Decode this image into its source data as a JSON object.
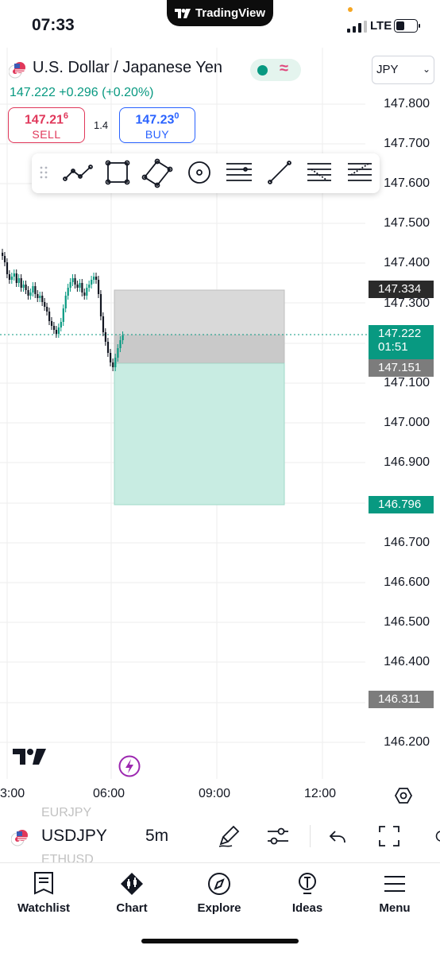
{
  "status_bar": {
    "time": "07:33",
    "network": "LTE"
  },
  "top_pill": {
    "label": "TradingView"
  },
  "header": {
    "instrument": "U.S. Dollar / Japanese Yen",
    "last_price": "147.222",
    "change": "+0.296 (+0.20%)",
    "currency_select": "JPY",
    "market_status_color": "#089981"
  },
  "trade": {
    "sell_price_main": "147.21",
    "sell_price_sup": "6",
    "sell_label": "SELL",
    "spread": "1.4",
    "buy_price_main": "147.23",
    "buy_price_sup": "0",
    "buy_label": "BUY"
  },
  "drawing_toolbar": {
    "tools": [
      "trend-lines-icon",
      "rectangle-icon",
      "rotated-rectangle-icon",
      "circle-icon",
      "horizontal-lines-icon",
      "line-icon",
      "fib-retracement-icon",
      "pitchfork-lines-icon"
    ]
  },
  "price_axis": {
    "labels": [
      "147.800",
      "147.700",
      "147.600",
      "147.500",
      "147.400",
      "147.300",
      "147.100",
      "147.000",
      "146.900",
      "146.700",
      "146.600",
      "146.500",
      "146.400",
      "146.200"
    ],
    "tags": {
      "stop_loss": "147.334",
      "current_price": "147.222",
      "countdown": "01:51",
      "entry": "147.151",
      "take_profit": "146.796",
      "low_marker": "146.311"
    }
  },
  "colors": {
    "up": "#089981",
    "down": "#131722",
    "loss_zone": "#d9d9d9",
    "profit_zone": "#c8ece2",
    "sell": "#e0375a",
    "buy": "#2962ff"
  },
  "time_axis": {
    "labels": [
      "3:00",
      "06:00",
      "09:00",
      "12:00"
    ]
  },
  "bottom_toolbar": {
    "symbol": "USDJPY",
    "interval": "5m",
    "ghost_above": "EURJPY",
    "ghost_below": "ETHUSD"
  },
  "nav": {
    "items": [
      {
        "label": "Watchlist",
        "icon": "watchlist-icon"
      },
      {
        "label": "Chart",
        "icon": "chart-icon"
      },
      {
        "label": "Explore",
        "icon": "compass-icon"
      },
      {
        "label": "Ideas",
        "icon": "lightbulb-icon"
      },
      {
        "label": "Menu",
        "icon": "hamburger-icon"
      }
    ]
  }
}
